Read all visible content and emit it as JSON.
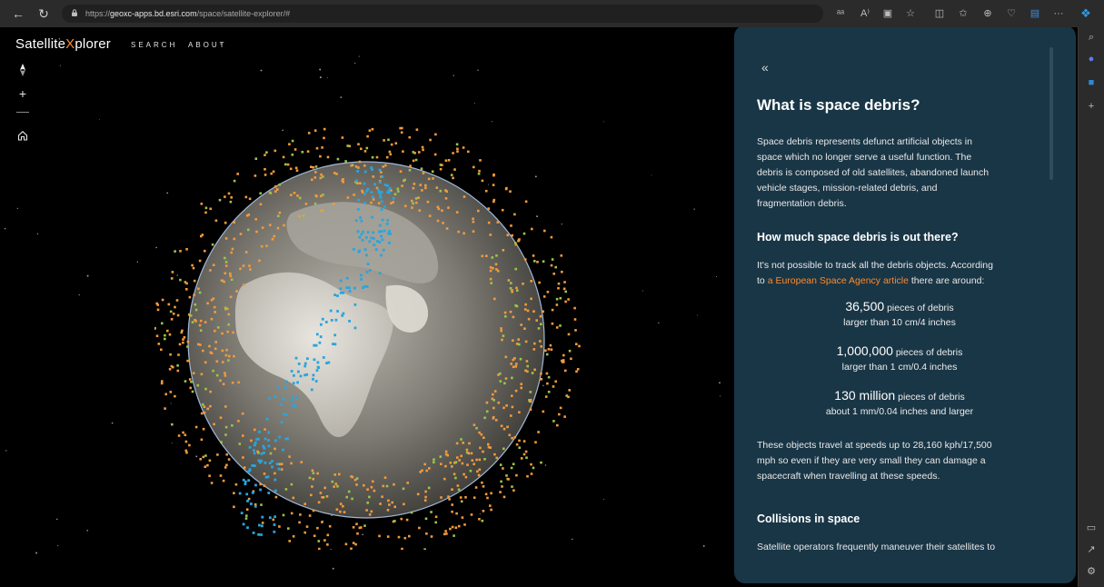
{
  "browser": {
    "url_prefix": "https://",
    "url_host": "geoxc-apps.bd.esri.com",
    "url_path": "/space/satellite-explorer/#"
  },
  "app": {
    "title_main": "Satellite",
    "title_x": "X",
    "title_rest": "plorer",
    "nav": [
      "SEARCH",
      "ABOUT"
    ]
  },
  "map_controls": {
    "compass_icon": "compass-icon",
    "zoom_in": "+",
    "zoom_out": "−",
    "home_icon": "home-icon"
  },
  "panel": {
    "collapse_label": "«",
    "heading": "What is space debris?",
    "intro_lines": [
      "Space debris represents defunct artificial objects in",
      "space which no longer serve a useful function. The",
      "debris is composed of old satellites, abandoned launch",
      "vehicle stages, mission-related debris, and",
      "fragmentation debris."
    ],
    "subheading_amount": "How much space debris is out there?",
    "amount_line1": "It's not possible to track all the debris objects. According",
    "amount_line2_prefix": "to ",
    "amount_link": "a European Space Agency article",
    "amount_line2_suffix": " there are around:",
    "stats": [
      {
        "number": "36,500",
        "unit": " pieces of debris",
        "sub": "larger than 10 cm/4 inches"
      },
      {
        "number": "1,000,000",
        "unit": " pieces of debris",
        "sub": "larger than 1 cm/0.4 inches"
      },
      {
        "number": "130 million",
        "unit": " pieces of debris",
        "sub": "about 1 mm/0.04 inches and larger"
      }
    ],
    "speed_lines": [
      "These objects travel at speeds up to 28,160 kph/17,500",
      "mph so even if they are very small they can damage a",
      "spacecraft when travelling at these speeds."
    ],
    "subheading_collisions": "Collisions in space",
    "collisions_line": "Satellite operators frequently maneuver their satellites to"
  },
  "colors": {
    "accent": "#ff8a2a",
    "panel_bg": "#193646",
    "debris_orange": "#f39a3c",
    "debris_green": "#9cc44a",
    "debris_blue": "#2aa5dc"
  },
  "toolbar_icons": [
    "read-aloud-icon",
    "text-size-icon",
    "immersive-reader-icon",
    "favorite-star-icon",
    "split-screen-icon",
    "favorites-icon",
    "collections-icon",
    "browser-essentials-icon",
    "extension-icon",
    "more-icon",
    "copilot-icon"
  ],
  "sidebar_icons": [
    "search-icon",
    "copilot-icon",
    "outlook-icon",
    "add-icon",
    "sidebar-layout-icon",
    "external-link-icon",
    "settings-icon"
  ]
}
